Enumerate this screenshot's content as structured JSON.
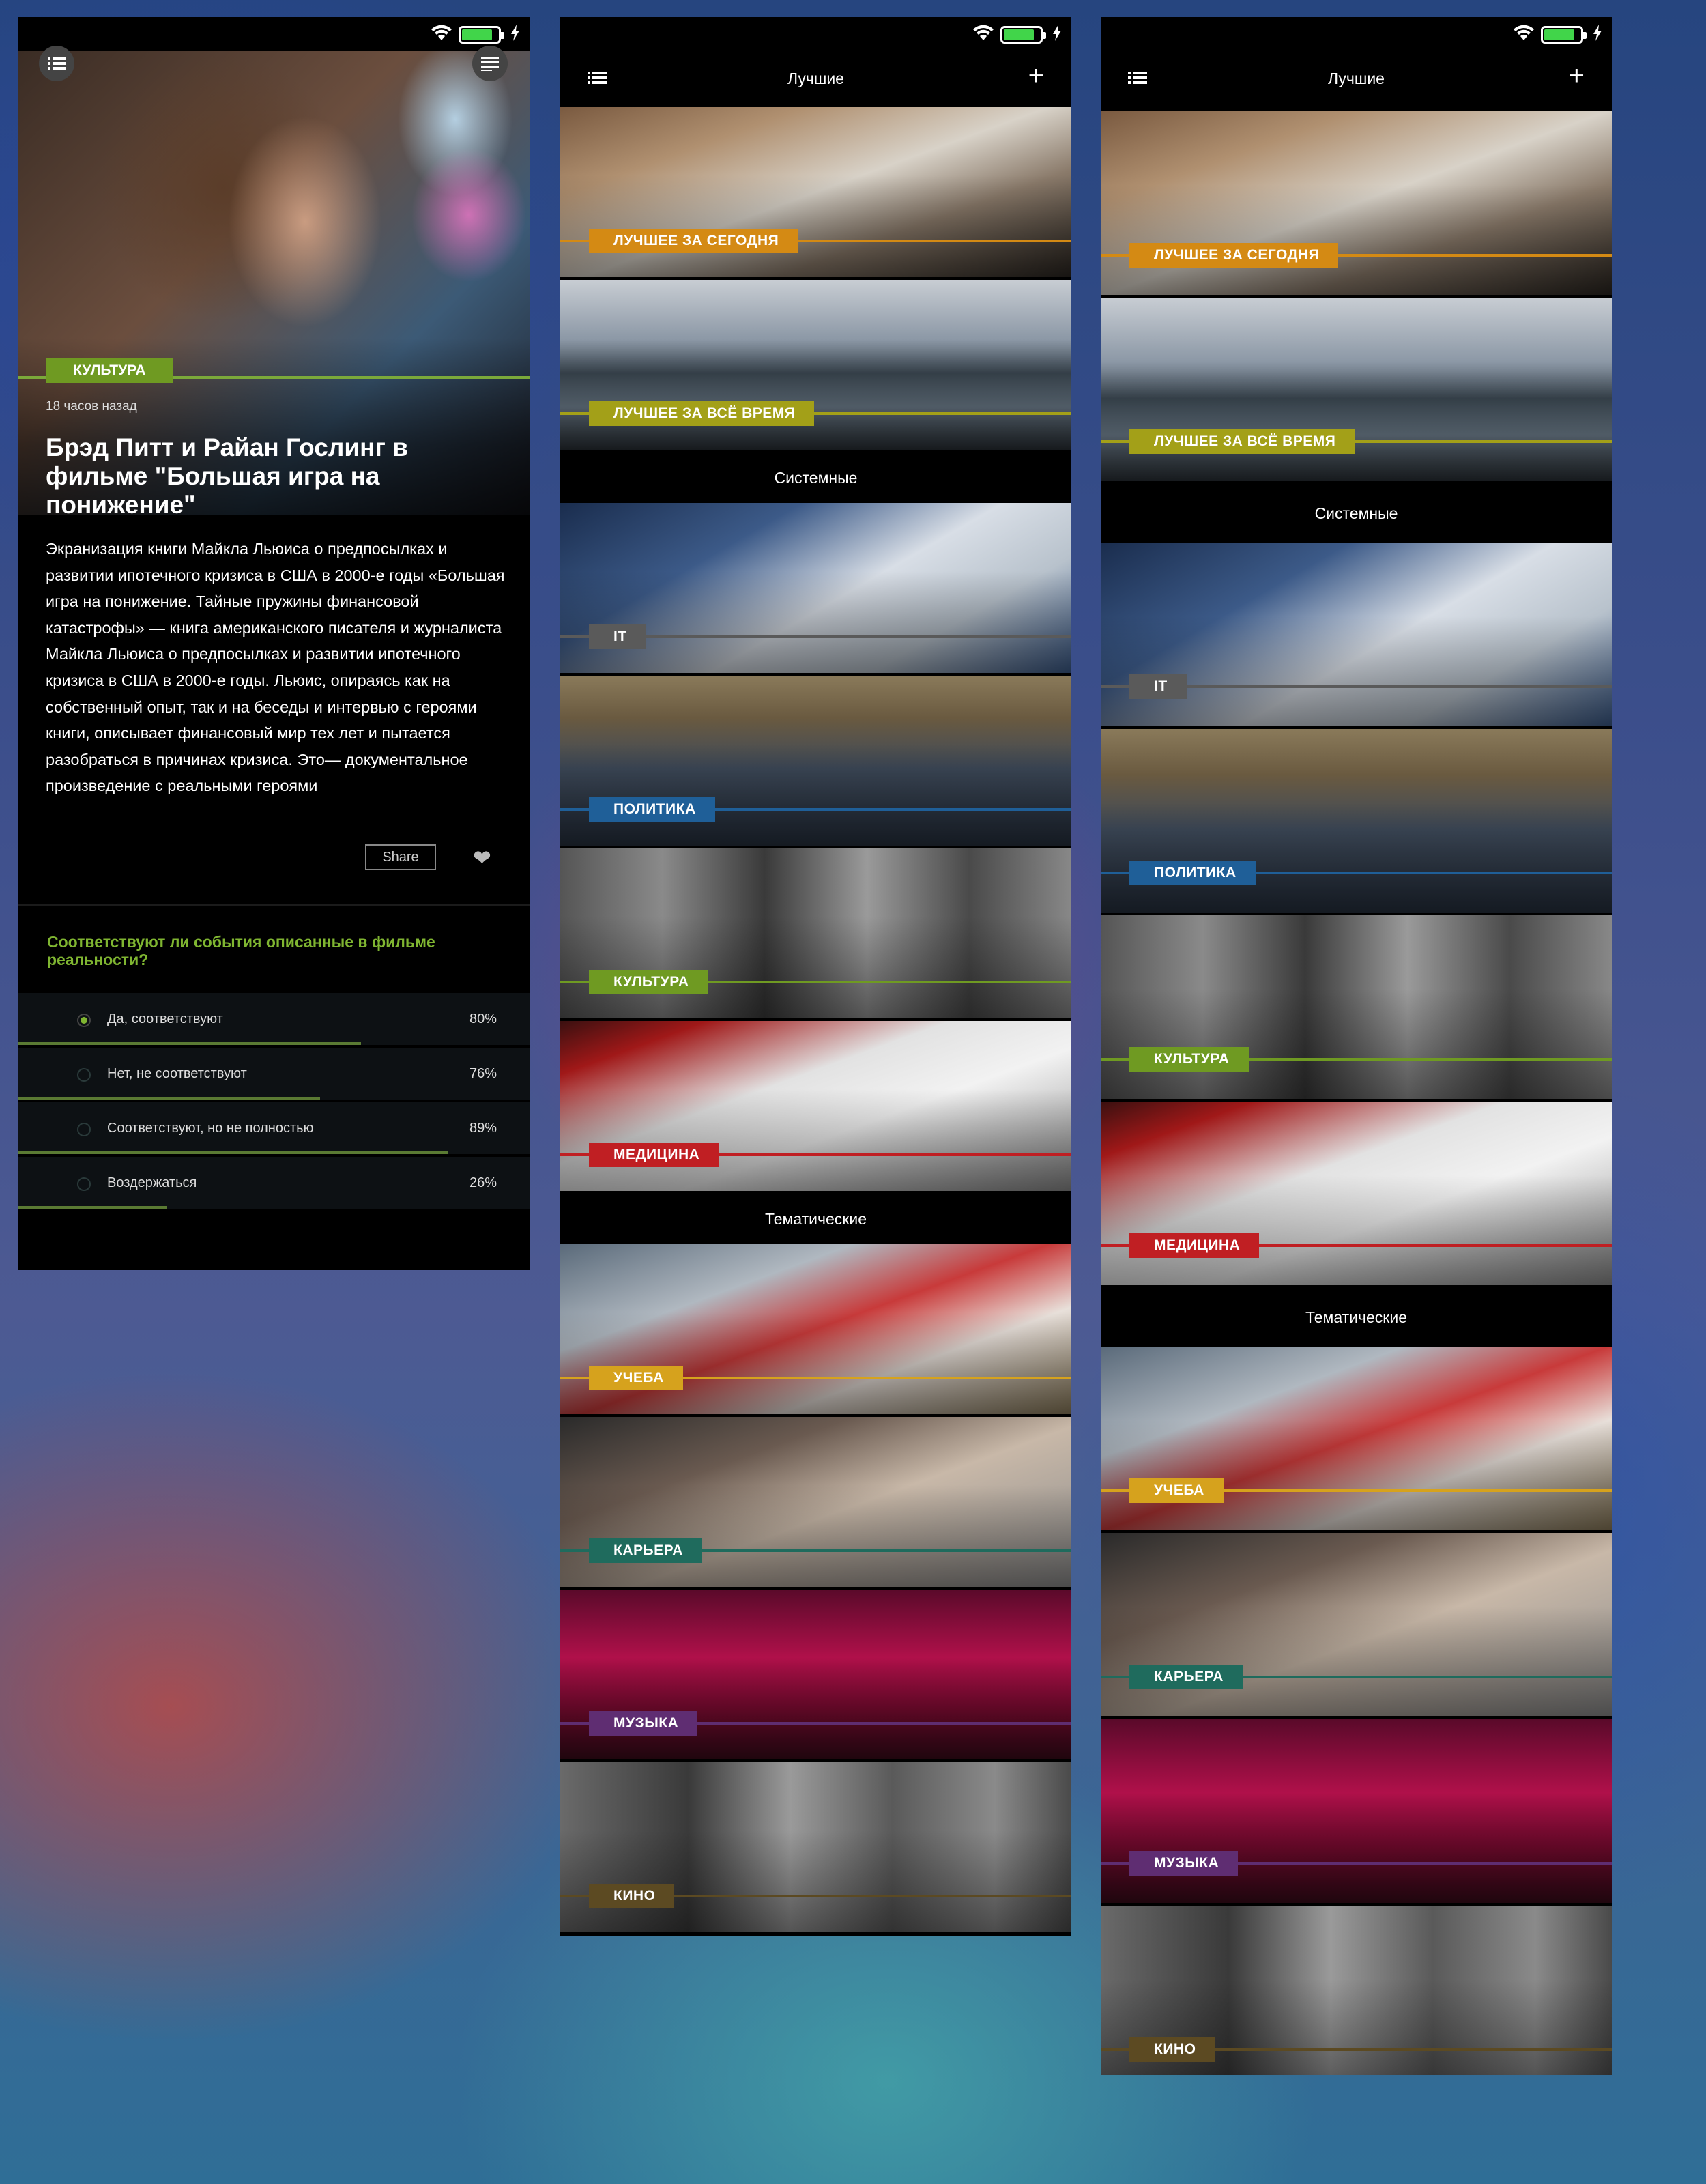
{
  "article_screen": {
    "category": "КУЛЬТУРА",
    "time_ago": "18 часов назад",
    "headline": "Брэд Питт и Райан Гослинг в фильме \"Большая игра на понижение\"",
    "body": "Экранизация книги Майкла Льюиса о предпосылках и развитии ипотечного кризиса в США в 2000-е годы «Большая игра на понижение. Тайные пружины финансовой катастрофы» — книга американского писателя и журналиста Майкла Льюиса о предпосылках и развитии ипотечного кризиса в США в 2000-е годы. Льюис, опираясь как на собственный опыт, так и на беседы и интервью с героями книги, описывает финансовый мир тех лет и пытается разобраться в причинах кризиса. Это— документальное произведение с реальными героями",
    "share_label": "Share",
    "heart_icon": "heart-icon",
    "poll": {
      "question": "Соответствуют ли события описанные в фильме реальности?",
      "options": [
        {
          "label": "Да, соответствуют",
          "percent": "80%",
          "value": 0.67,
          "selected": true
        },
        {
          "label": "Нет, не соответствуют",
          "percent": "76%",
          "value": 0.59,
          "selected": false
        },
        {
          "label": "Соответствуют, но не полностью",
          "percent": "89%",
          "value": 0.84,
          "selected": false
        },
        {
          "label": "Воздержаться",
          "percent": "26%",
          "value": 0.29,
          "selected": false
        }
      ],
      "accent_color": "#7fb531"
    }
  },
  "categories_screen": {
    "title": "Лучшие",
    "plus_label": "+",
    "best": [
      {
        "label": "ЛУЧШЕЕ ЗА СЕГОДНЯ",
        "color": "#d48a14"
      },
      {
        "label": "ЛУЧШЕЕ ЗА ВСЁ ВРЕМЯ",
        "color": "#a3a018"
      }
    ],
    "system_title": "Системные",
    "system": [
      {
        "label": "IT",
        "color": "#5a5a5a"
      },
      {
        "label": "ПОЛИТИКА",
        "color": "#1f5f98"
      },
      {
        "label": "КУЛЬТУРА",
        "color": "#6f9a22"
      },
      {
        "label": "МЕДИЦИНА",
        "color": "#c01f23"
      }
    ],
    "thematic_title": "Тематические",
    "thematic": [
      {
        "label": "УЧЕБА",
        "color": "#d6a21d"
      },
      {
        "label": "КАРЬЕРА",
        "color": "#1f6b5d"
      },
      {
        "label": "МУЗЫКА",
        "color": "#5f2d72"
      },
      {
        "label": "КИНО",
        "color": "#5c4a22"
      }
    ]
  }
}
